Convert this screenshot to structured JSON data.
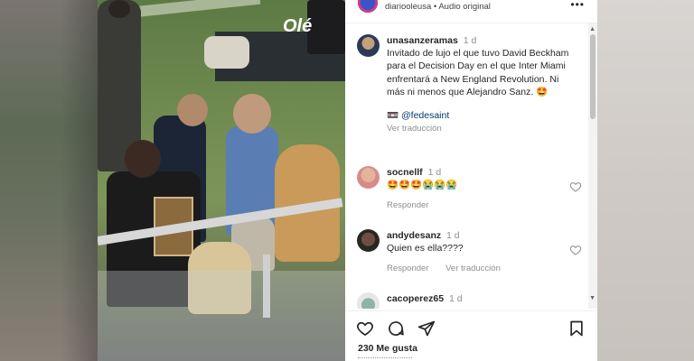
{
  "header": {
    "username": "diariooleusa",
    "separator": "•",
    "audio": "Audio original",
    "more_icon": "more-horizontal-icon"
  },
  "video": {
    "watermark": "Olé"
  },
  "comments": [
    {
      "user": "unasanzeramas",
      "time": "1 d",
      "text": "Invitado de lujo el que tuvo David Beckham para el Decision Day en el que Inter Miami enfrentará a New England Revolution. Ni más ni menos que Alejandro Sanz. 🤩",
      "mention": "@fedesaint",
      "mention_icon": "camera-icon",
      "translate": "Ver traducción"
    },
    {
      "user": "socnellf",
      "time": "1 d",
      "text": "🤩🤩🤩😭😭😭",
      "reply": "Responder"
    },
    {
      "user": "andydesanz",
      "time": "1 d",
      "text": "Quien es ella????",
      "reply": "Responder",
      "translate": "Ver traducción"
    },
    {
      "user": "cacoperez65",
      "time": "1 d"
    }
  ],
  "toolbar": {
    "icons": [
      "heart-icon",
      "comment-icon",
      "share-icon",
      "bookmark-icon"
    ]
  },
  "likes": "230 Me gusta",
  "colors": {
    "text": "#262626",
    "muted": "#8e8e8e",
    "link": "#00376b"
  }
}
